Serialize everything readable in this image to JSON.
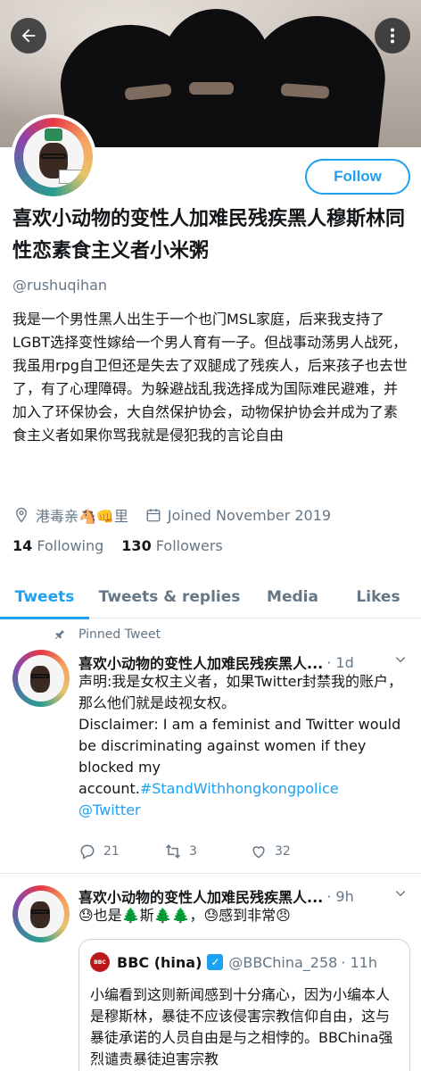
{
  "profile": {
    "display_name": "喜欢小动物的变性人加难民残疾黑人穆斯林同性恋素食主义者小米粥",
    "handle": "@rushuqihan",
    "follow_label": "Follow",
    "bio": "我是一个男性黑人出生于一个也门MSL家庭，后来我支持了LGBT选择变性嫁给一个男人育有一子。但战事动荡男人战死，我虽用rpg自卫但还是失去了双腿成了残疾人，后来孩子也去世了，有了心理障碍。为躲避战乱我选择成为国际难民避难，并加入了环保协会，大自然保护协会，动物保护协会并成为了素食主义者如果你骂我就是侵犯我的言论自由",
    "location": "港毒亲🐴👊里",
    "joined": "Joined November 2019",
    "following_count": "14",
    "following_label": "Following",
    "followers_count": "130",
    "followers_label": "Followers"
  },
  "tabs": [
    "Tweets",
    "Tweets & replies",
    "Media",
    "Likes"
  ],
  "pinned_label": "Pinned Tweet",
  "tweets": [
    {
      "name": "喜欢小动物的变性人加难民残疾黑人...",
      "time": "· 1d",
      "text_zh": "声明:我是女权主义者，如果Twitter封禁我的账户，那么他们就是歧视女权。",
      "text_en": "Disclaimer: I am a feminist and Twitter would be discriminating against women if they blocked my account.",
      "hashtag": "#StandWithhongkongpolice",
      "mention": "@Twitter",
      "replies": "21",
      "retweets": "3",
      "likes": "32"
    },
    {
      "name": "喜欢小动物的变性人加难民残疾黑人...",
      "time": "· 9h",
      "text": "😓也是🌲斯🌲🌲，😓感到非常😠"
    }
  ],
  "quote": {
    "name": "BBC (hina)",
    "logo_text": "BBC",
    "handle": "@BBChina_258",
    "time": "· 11h",
    "text": "小编看到这则新闻感到十分痛心，因为小编本人是穆斯林，暴徒不应该侵害宗教信仰自由，这与暴徒承诺的人员自由是与之相悖的。BBChina强烈谴责暴徒迫害宗教"
  },
  "colors": {
    "accent": "#1da1f2",
    "muted": "#657786",
    "text": "#14171a"
  },
  "icons": [
    "back-arrow-icon",
    "more-vertical-icon",
    "location-icon",
    "calendar-icon",
    "pin-icon",
    "reply-icon",
    "retweet-icon",
    "like-icon",
    "chevron-down-icon",
    "verified-icon"
  ]
}
